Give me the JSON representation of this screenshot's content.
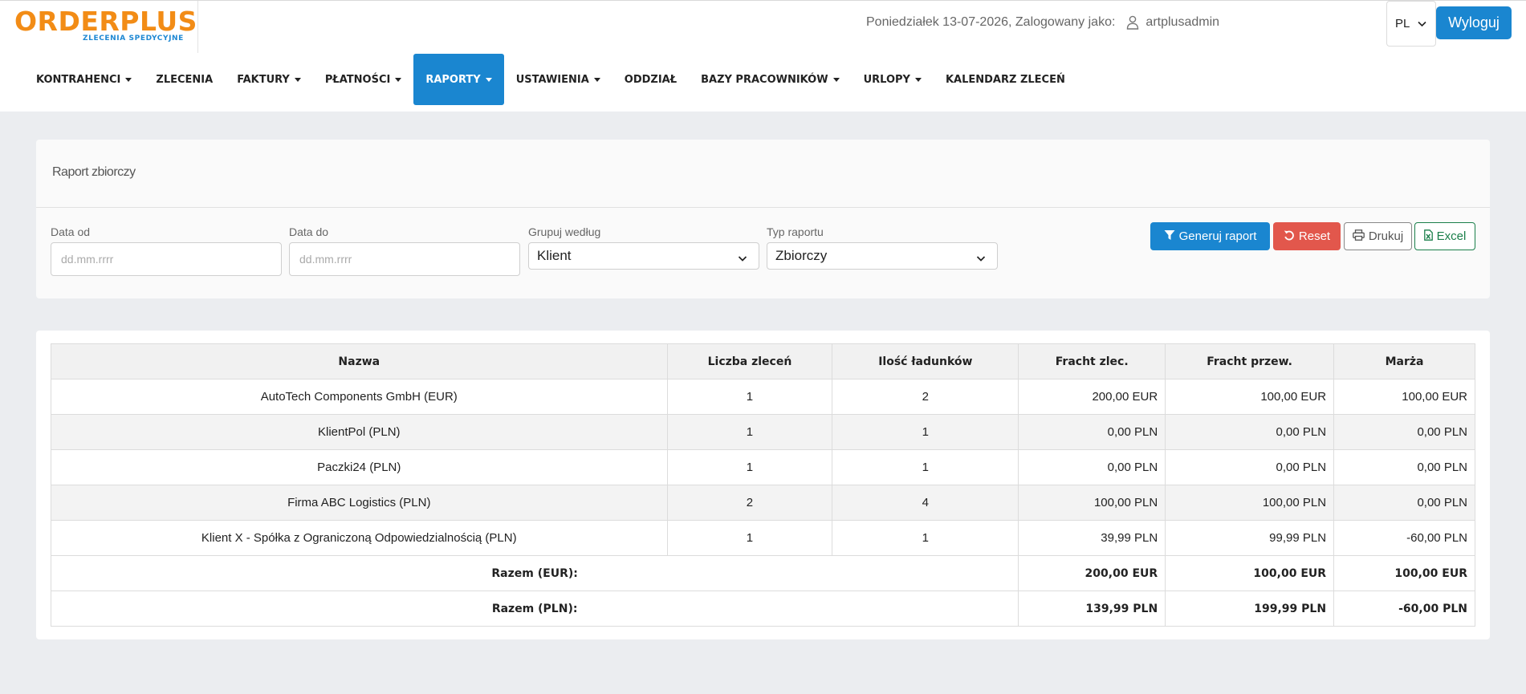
{
  "brand": {
    "name": "ORDERPLUS",
    "tagline": "ZLECENIA SPEDYCYJNE",
    "primary": "#f28c16",
    "accent": "#1a86d0"
  },
  "header": {
    "date_text": "Poniedziałek 13-07-2026, Zalogowany jako:",
    "user_icon": "user-icon",
    "username": "artplusadmin",
    "language": "PL",
    "logout_label": "Wyloguj"
  },
  "nav": [
    {
      "label": "KONTRAHENCI",
      "dropdown": true,
      "active": false
    },
    {
      "label": "ZLECENIA",
      "dropdown": false,
      "active": false
    },
    {
      "label": "FAKTURY",
      "dropdown": true,
      "active": false
    },
    {
      "label": "PŁATNOŚCI",
      "dropdown": true,
      "active": false
    },
    {
      "label": "RAPORTY",
      "dropdown": true,
      "active": true
    },
    {
      "label": "USTAWIENIA",
      "dropdown": true,
      "active": false
    },
    {
      "label": "ODDZIAŁ",
      "dropdown": false,
      "active": false
    },
    {
      "label": "BAZY PRACOWNIKÓW",
      "dropdown": true,
      "active": false
    },
    {
      "label": "URLOPY",
      "dropdown": true,
      "active": false
    },
    {
      "label": "KALENDARZ ZLECEŃ",
      "dropdown": false,
      "active": false
    }
  ],
  "report": {
    "title": "Raport zbiorczy",
    "filters": {
      "date_from_label": "Data od",
      "date_from_placeholder": "dd.mm.rrrr",
      "date_to_label": "Data do",
      "date_to_placeholder": "dd.mm.rrrr",
      "group_by_label": "Grupuj według",
      "group_by_value": "Klient",
      "report_type_label": "Typ raportu",
      "report_type_value": "Zbiorczy"
    },
    "buttons": {
      "generate": "Generuj raport",
      "reset": "Reset",
      "print": "Drukuj",
      "excel": "Excel"
    }
  },
  "table": {
    "headers": [
      "Nazwa",
      "Liczba zleceń",
      "Ilość ładunków",
      "Fracht zlec.",
      "Fracht przew.",
      "Marża"
    ],
    "rows": [
      [
        "AutoTech Components GmbH (EUR)",
        "1",
        "2",
        "200,00 EUR",
        "100,00 EUR",
        "100,00 EUR"
      ],
      [
        "KlientPol (PLN)",
        "1",
        "1",
        "0,00 PLN",
        "0,00 PLN",
        "0,00 PLN"
      ],
      [
        "Paczki24 (PLN)",
        "1",
        "1",
        "0,00 PLN",
        "0,00 PLN",
        "0,00 PLN"
      ],
      [
        "Firma ABC Logistics (PLN)",
        "2",
        "4",
        "100,00 PLN",
        "100,00 PLN",
        "0,00 PLN"
      ],
      [
        "Klient X - Spółka z Ograniczoną Odpowiedzialnością (PLN)",
        "1",
        "1",
        "39,99 PLN",
        "99,99 PLN",
        "-60,00 PLN"
      ]
    ],
    "totals": [
      [
        "Razem (EUR):",
        "200,00 EUR",
        "100,00 EUR",
        "100,00 EUR"
      ],
      [
        "Razem (PLN):",
        "139,99 PLN",
        "199,99 PLN",
        "-60,00 PLN"
      ]
    ]
  }
}
